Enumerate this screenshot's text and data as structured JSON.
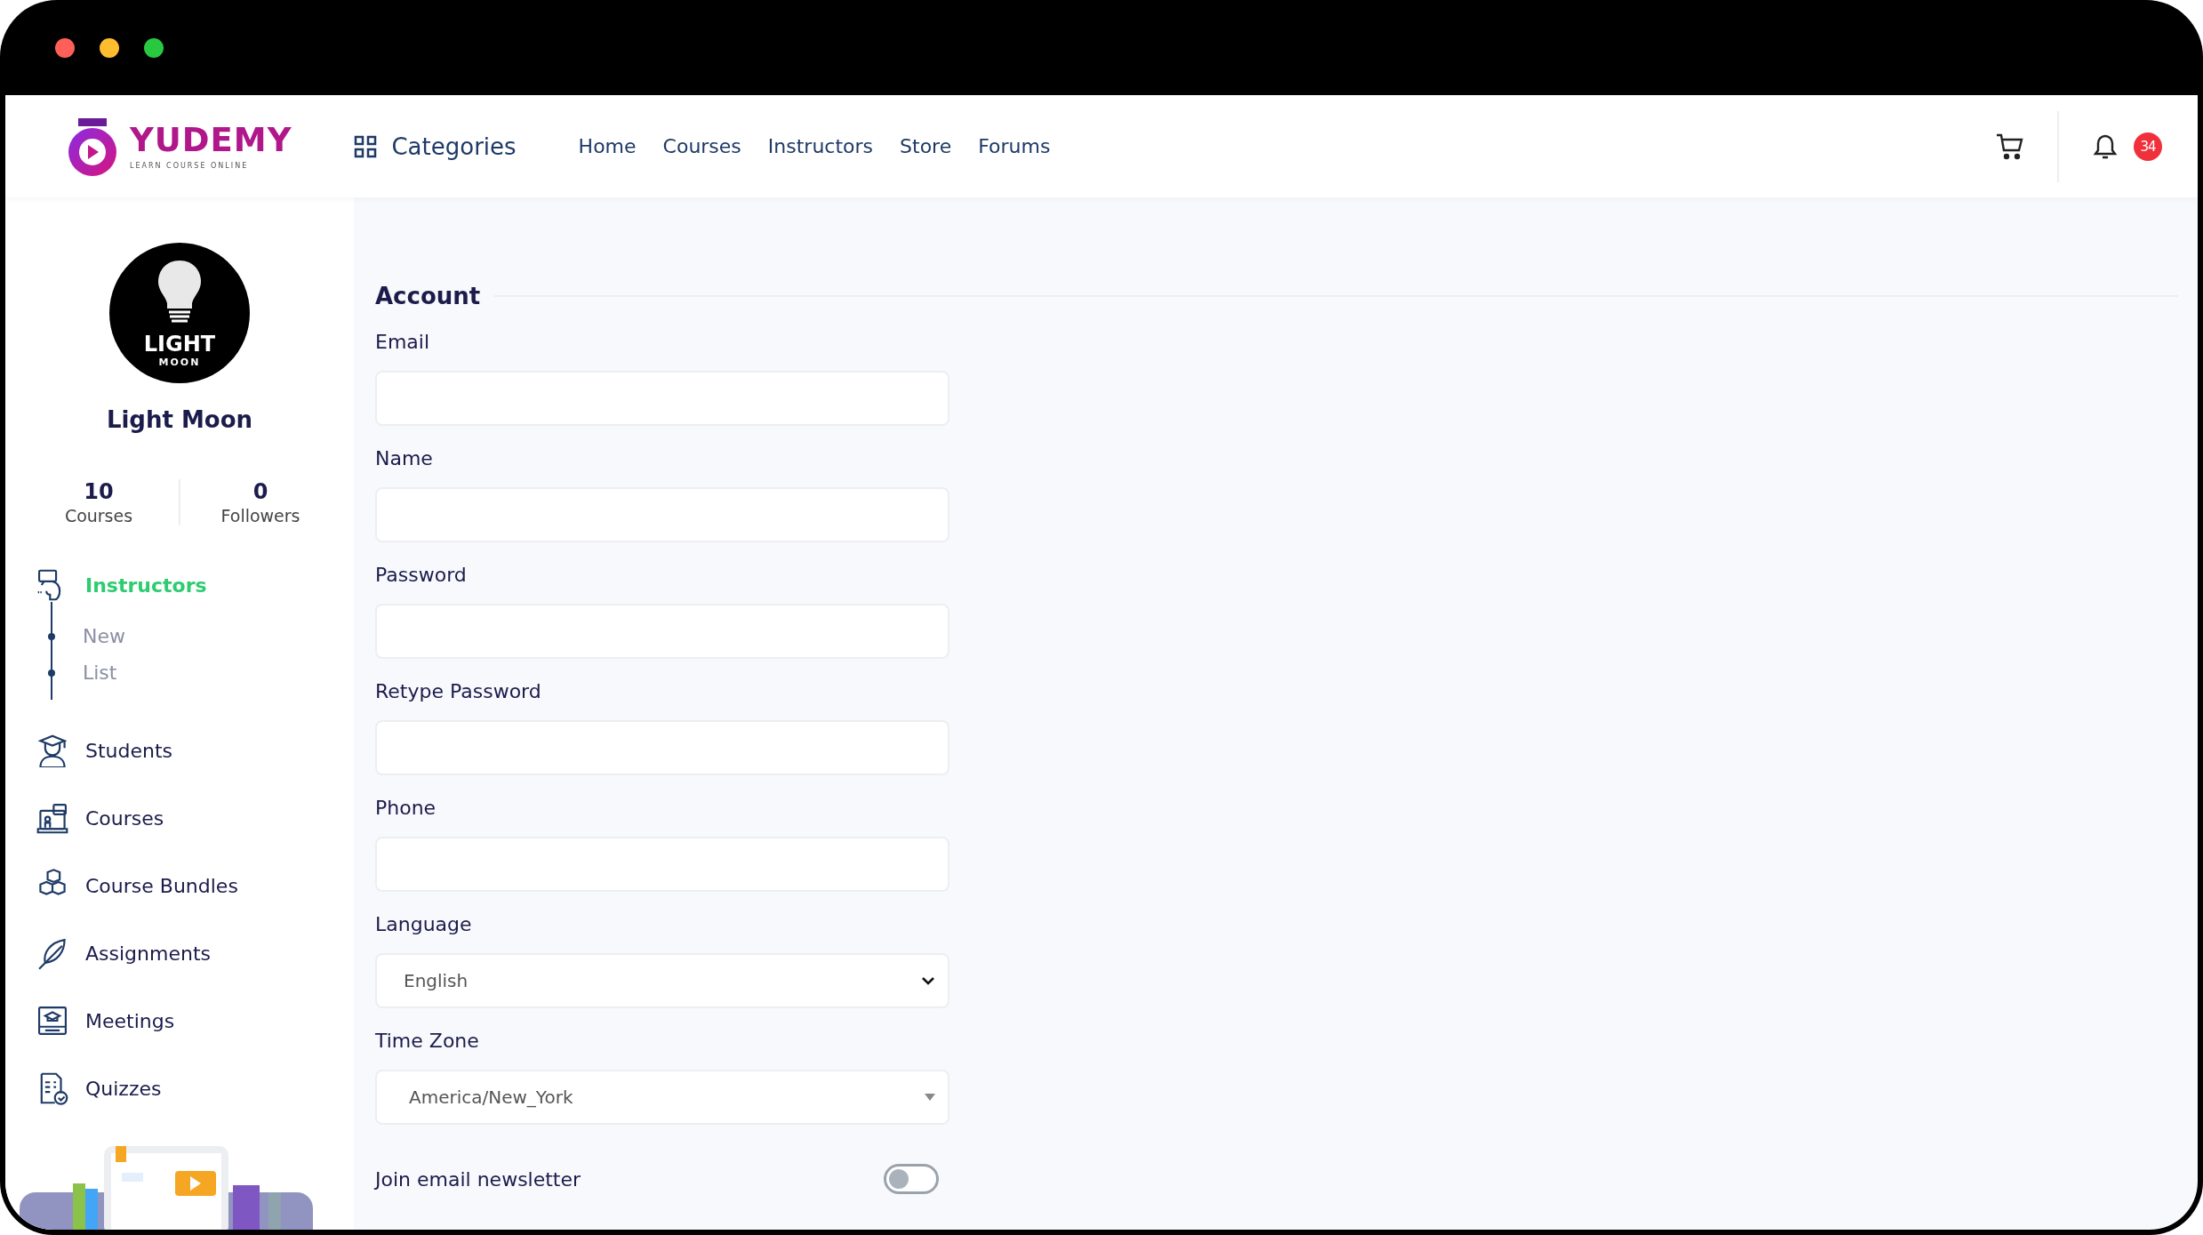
{
  "window_controls": [
    {
      "color": "#ff5f57"
    },
    {
      "color": "#febc2e"
    },
    {
      "color": "#28c840"
    }
  ],
  "header": {
    "logo": {
      "name": "YUDEMY",
      "tagline": "LEARN  COURSE  ONLINE"
    },
    "categories": "Categories",
    "nav": [
      "Home",
      "Courses",
      "Instructors",
      "Store",
      "Forums"
    ],
    "notification_count": "34"
  },
  "profile": {
    "avatar_text": [
      "LIGHT",
      "MOON"
    ],
    "name": "Light Moon",
    "stats": [
      {
        "value": "10",
        "label": "Courses"
      },
      {
        "value": "0",
        "label": "Followers"
      }
    ]
  },
  "menu": [
    {
      "label": "Instructors",
      "selected": true,
      "children": [
        {
          "label": "New"
        },
        {
          "label": "List"
        }
      ]
    },
    {
      "label": "Students",
      "selected": false
    },
    {
      "label": "Courses",
      "selected": false
    },
    {
      "label": "Course Bundles",
      "selected": false
    },
    {
      "label": "Assignments",
      "selected": false
    },
    {
      "label": "Meetings",
      "selected": false
    },
    {
      "label": "Quizzes",
      "selected": false
    }
  ],
  "form": {
    "section": "Account",
    "fields": [
      {
        "label": "Email",
        "kind": "text"
      },
      {
        "label": "Name",
        "kind": "text"
      },
      {
        "label": "Password",
        "kind": "text"
      },
      {
        "label": "Retype Password",
        "kind": "text"
      },
      {
        "label": "Phone",
        "kind": "text"
      },
      {
        "label": "Language",
        "kind": "select",
        "value": "English"
      },
      {
        "label": "Time Zone",
        "kind": "combo",
        "value": "America/New_York"
      }
    ],
    "toggles": [
      {
        "label": "Join email newsletter",
        "on": false
      }
    ]
  }
}
